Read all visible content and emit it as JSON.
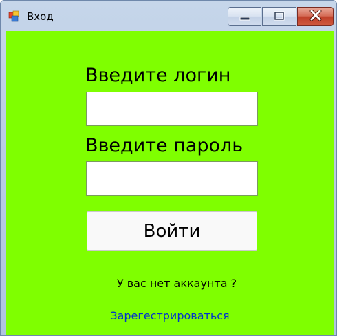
{
  "window": {
    "title": "Вход",
    "minimize_icon": "minimize-icon",
    "maximize_icon": "maximize-icon",
    "close_icon": "close-icon"
  },
  "form": {
    "login_label": "Введите логин",
    "login_value": "",
    "password_label": "Введите пароль",
    "password_value": "",
    "login_button": "Войти",
    "no_account_text": "У вас нет аккаунта ?",
    "register_link": "Зарегестрироваться"
  },
  "colors": {
    "client_background": "#7fff00",
    "link": "#0033cc"
  }
}
